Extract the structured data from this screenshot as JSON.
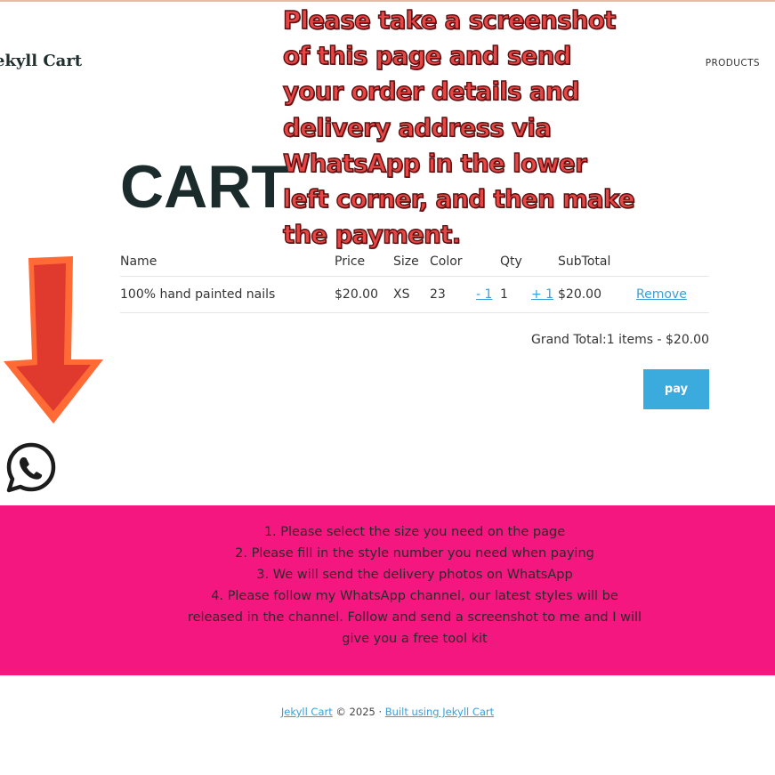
{
  "header": {
    "brand": "ekyll Cart",
    "nav_products": "PRODUCTS"
  },
  "overlay_message": "Please take a screenshot of this page and send your order details and delivery address via WhatsApp in the lower left corner, and then make the payment.",
  "page_title": "CART",
  "cart": {
    "columns": [
      "Name",
      "Price",
      "Size",
      "Color",
      "Qty",
      "SubTotal"
    ],
    "items": [
      {
        "name": "100% hand painted nails",
        "price": "$20.00",
        "size": "XS",
        "color": "23",
        "minus_label": "- 1",
        "qty": "1",
        "plus_label": "+ 1",
        "subtotal": "$20.00",
        "remove_label": "Remove"
      }
    ],
    "grand_total": "Grand Total:1 items - $20.00",
    "pay_label": "pay"
  },
  "notes": [
    "1. Please select the size you need on the page",
    "2. Please fill in the style number you need when paying",
    "3. We will send the delivery photos on WhatsApp",
    "4. Please follow my WhatsApp channel, our latest styles will be released in the channel. Follow and send a screenshot to me and I will give you a free tool kit"
  ],
  "footer": {
    "link1": "Jekyll Cart",
    "middle": " © 2025 · ",
    "link2": "Built using Jekyll Cart"
  },
  "colors": {
    "pink_band": "#f3177f",
    "pay_button": "#3aabdc",
    "link": "#3a9fd6",
    "overlay_text": "#e84545"
  },
  "icons": [
    "down-arrow-icon",
    "whatsapp-icon"
  ]
}
